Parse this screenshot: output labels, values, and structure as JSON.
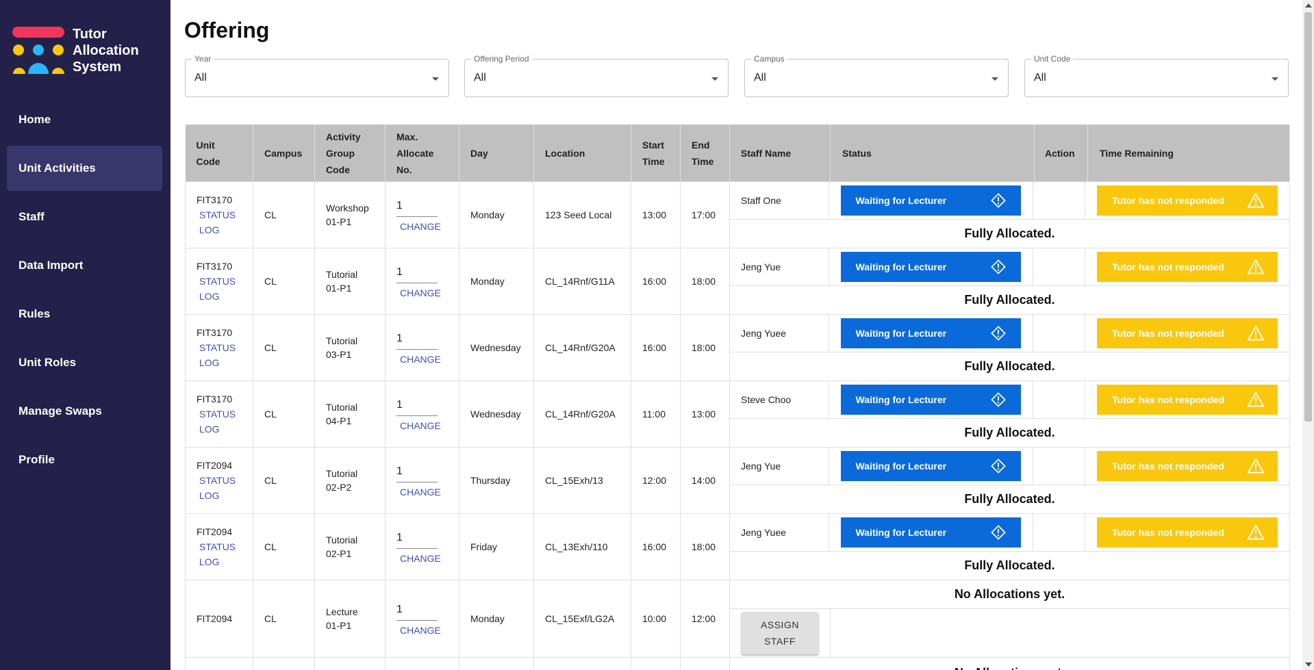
{
  "app": {
    "name_line1": "Tutor",
    "name_line2": "Allocation",
    "name_line3": "System"
  },
  "sidebar": {
    "items": [
      {
        "label": "Home"
      },
      {
        "label": "Unit Activities"
      },
      {
        "label": "Staff"
      },
      {
        "label": "Data Import"
      },
      {
        "label": "Rules"
      },
      {
        "label": "Unit Roles"
      },
      {
        "label": "Manage Swaps"
      },
      {
        "label": "Profile"
      }
    ]
  },
  "page": {
    "title": "Offering"
  },
  "filters": [
    {
      "label": "Year",
      "value": "All"
    },
    {
      "label": "Offering Period",
      "value": "All"
    },
    {
      "label": "Campus",
      "value": "All"
    },
    {
      "label": "Unit Code",
      "value": "All"
    }
  ],
  "table": {
    "headers": {
      "unit_code_1": "Unit",
      "unit_code_2": "Code",
      "campus": "Campus",
      "activity_1": "Activity",
      "activity_2": "Group",
      "activity_3": "Code",
      "max_1": "Max.",
      "max_2": "Allocate",
      "max_3": "No.",
      "day": "Day",
      "location": "Location",
      "start_1": "Start",
      "start_2": "Time",
      "end_1": "End",
      "end_2": "Time",
      "staff_name": "Staff Name",
      "status": "Status",
      "action": "Action",
      "time_remaining": "Time Remaining"
    },
    "status_link": "STATUS",
    "log_link": "LOG",
    "change_link": "CHANGE",
    "rows": [
      {
        "unit": "FIT3170",
        "campus": "CL",
        "act1": "Workshop",
        "act2": "01-P1",
        "max": "1",
        "day": "Monday",
        "location": "123 Seed Local",
        "start": "13:00",
        "end": "17:00",
        "staff": "Staff One",
        "status": "Waiting for Lecturer",
        "time": "Tutor has not responded",
        "alloc": "Fully Allocated."
      },
      {
        "unit": "FIT3170",
        "campus": "CL",
        "act1": "Tutorial",
        "act2": "01-P1",
        "max": "1",
        "day": "Monday",
        "location": "CL_14Rnf/G11A",
        "start": "16:00",
        "end": "18:00",
        "staff": "Jeng Yue",
        "status": "Waiting for Lecturer",
        "time": "Tutor has not responded",
        "alloc": "Fully Allocated."
      },
      {
        "unit": "FIT3170",
        "campus": "CL",
        "act1": "Tutorial",
        "act2": "03-P1",
        "max": "1",
        "day": "Wednesday",
        "location": "CL_14Rnf/G20A",
        "start": "16:00",
        "end": "18:00",
        "staff": "Jeng Yuee",
        "status": "Waiting for Lecturer",
        "time": "Tutor has not responded",
        "alloc": "Fully Allocated."
      },
      {
        "unit": "FIT3170",
        "campus": "CL",
        "act1": "Tutorial",
        "act2": "04-P1",
        "max": "1",
        "day": "Wednesday",
        "location": "CL_14Rnf/G20A",
        "start": "11:00",
        "end": "13:00",
        "staff": "Steve Choo",
        "status": "Waiting for Lecturer",
        "time": "Tutor has not responded",
        "alloc": "Fully Allocated."
      },
      {
        "unit": "FIT2094",
        "campus": "CL",
        "act1": "Tutorial",
        "act2": "02-P2",
        "max": "1",
        "day": "Thursday",
        "location": "CL_15Exh/13",
        "start": "12:00",
        "end": "14:00",
        "staff": "Jeng Yue",
        "status": "Waiting for Lecturer",
        "time": "Tutor has not responded",
        "alloc": "Fully Allocated."
      },
      {
        "unit": "FIT2094",
        "campus": "CL",
        "act1": "Tutorial",
        "act2": "02-P1",
        "max": "1",
        "day": "Friday",
        "location": "CL_13Exh/110",
        "start": "16:00",
        "end": "18:00",
        "staff": "Jeng Yuee",
        "status": "Waiting for Lecturer",
        "time": "Tutor has not responded",
        "alloc": "Fully Allocated."
      }
    ],
    "last_row": {
      "unit": "FIT2094",
      "campus": "CL",
      "act1": "Lecture",
      "act2": "01-P1",
      "max": "1",
      "day": "Monday",
      "location": "CL_15Exf/LG2A",
      "start": "10:00",
      "end": "12:00",
      "alloc": "No Allocations yet.",
      "assign_1": "ASSIGN",
      "assign_2": "STAFF"
    },
    "cut_off_text": "No Allocations yet."
  },
  "colors": {
    "sidebar": "#23214a",
    "sidebar_active": "#38366a",
    "status_blue": "#0b6ad9",
    "warning_yellow": "#f9c80e",
    "link": "#3f51b5",
    "logo_red": "#f2355b",
    "logo_yellow": "#f9c80e",
    "logo_blue": "#29b6f6"
  },
  "icons": {
    "status": "diamond-exclamation-icon",
    "time": "warning-triangle-icon"
  }
}
